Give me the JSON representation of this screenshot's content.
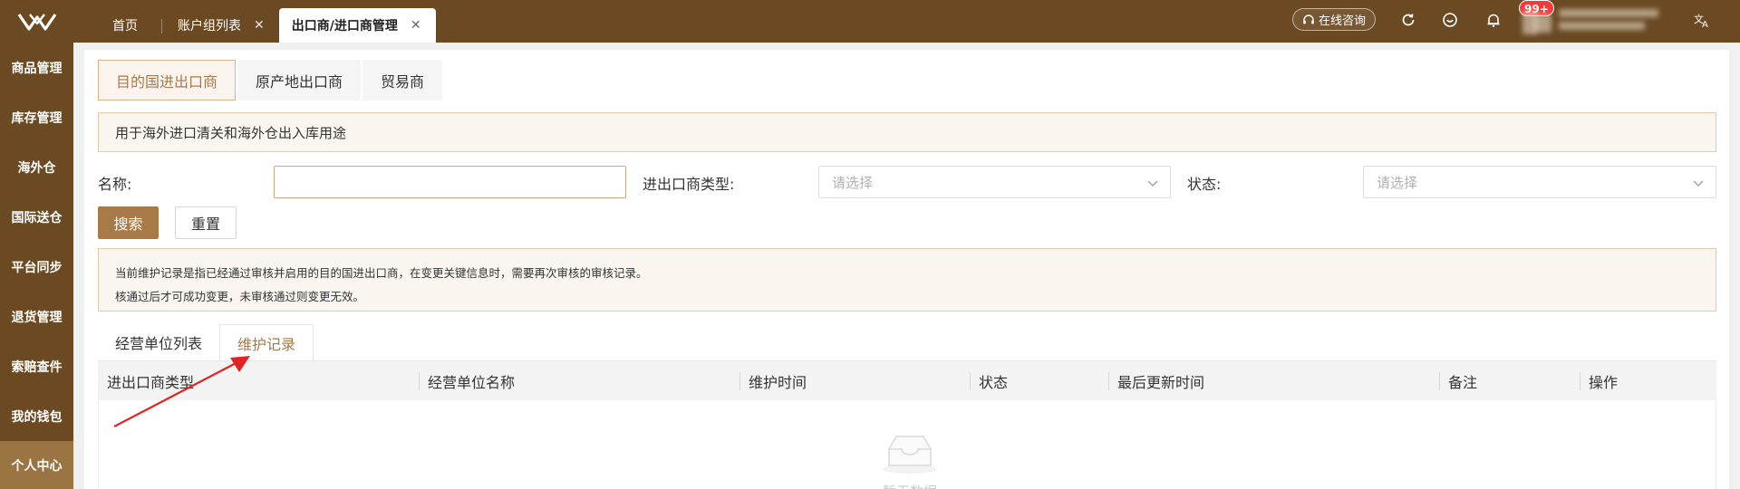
{
  "header": {
    "tabs": [
      {
        "label": "首页",
        "closable": false,
        "active": false
      },
      {
        "label": "账户组列表",
        "closable": true,
        "active": false
      },
      {
        "label": "出口商/进口商管理",
        "closable": true,
        "active": true
      }
    ],
    "consult_label": "在线咨询",
    "notification_count": "99+"
  },
  "sidebar": {
    "items": [
      {
        "label": "商品管理",
        "active": false
      },
      {
        "label": "库存管理",
        "active": false
      },
      {
        "label": "海外仓",
        "active": false
      },
      {
        "label": "国际送仓",
        "active": false
      },
      {
        "label": "平台同步",
        "active": false
      },
      {
        "label": "退货管理",
        "active": false
      },
      {
        "label": "索赔查件",
        "active": false
      },
      {
        "label": "我的钱包",
        "active": false
      },
      {
        "label": "个人中心",
        "active": true
      }
    ]
  },
  "subtabs": [
    {
      "label": "目的国进出口商",
      "active": true
    },
    {
      "label": "原产地出口商",
      "active": false
    },
    {
      "label": "贸易商",
      "active": false
    }
  ],
  "notice": "用于海外进口清关和海外仓出入库用途",
  "filters": {
    "name_label": "名称:",
    "name_value": "",
    "type_label": "进出口商类型:",
    "type_placeholder": "请选择",
    "status_label": "状态:",
    "status_placeholder": "请选择"
  },
  "buttons": {
    "search": "搜索",
    "reset": "重置"
  },
  "info": {
    "line1": "当前维护记录是指已经通过审核并启用的目的国进出口商，在变更关键信息时，需要再次审核的审核记录。",
    "line2": "核通过后才可成功变更，未审核通过则变更无效。"
  },
  "list_tabs": [
    {
      "label": "经营单位列表",
      "active": false
    },
    {
      "label": "维护记录",
      "active": true
    }
  ],
  "table": {
    "columns": [
      "进出口商类型",
      "经营单位名称",
      "维护时间",
      "状态",
      "最后更新时间",
      "备注",
      "操作"
    ],
    "empty_text": "暂无数据"
  },
  "colors": {
    "brand": "#6b4a23",
    "accent": "#a87a47",
    "annotation_arrow": "#e02424"
  }
}
